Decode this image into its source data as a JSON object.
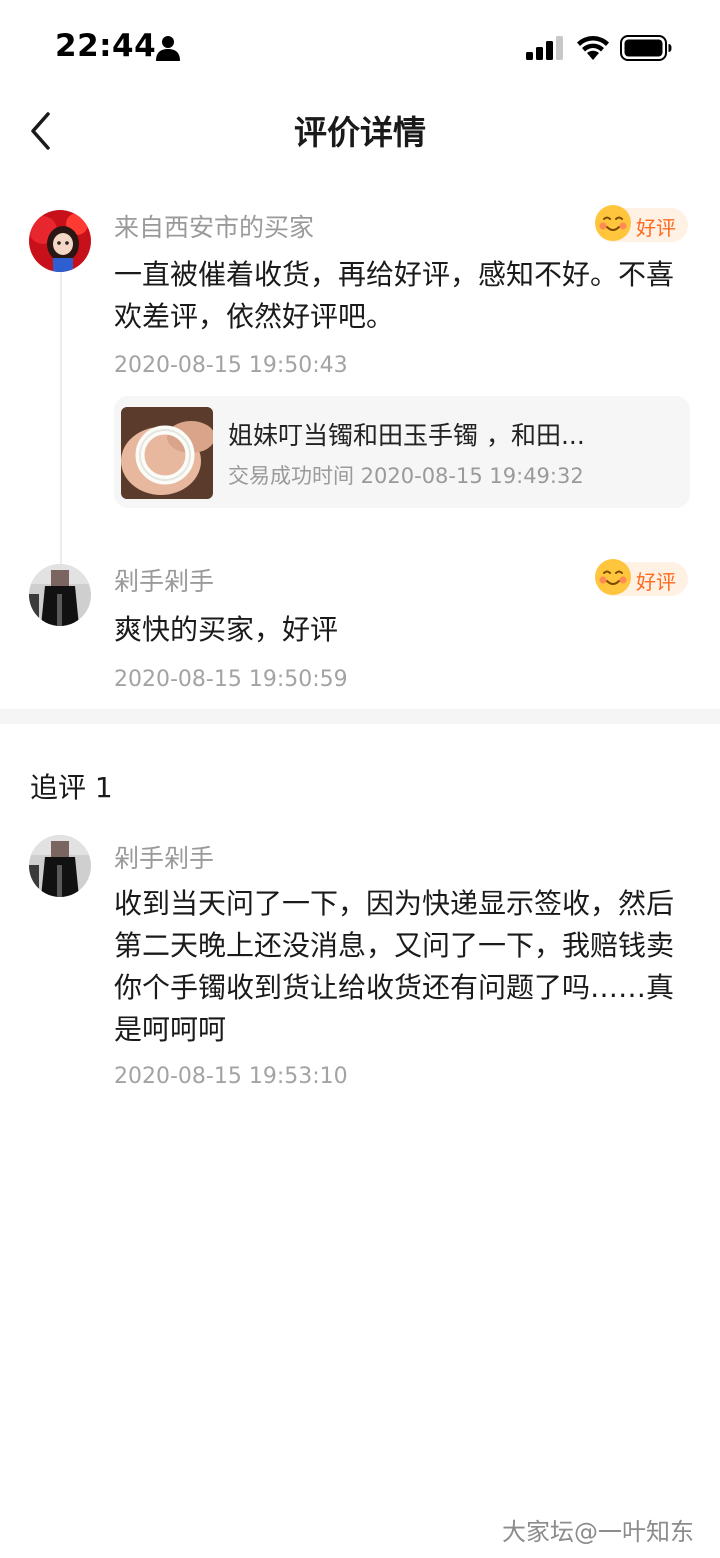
{
  "status_bar": {
    "time": "22:44"
  },
  "nav": {
    "title": "评价详情"
  },
  "reviews": [
    {
      "user": "来自西安市的买家",
      "badge": "好评",
      "text_lines": [
        "一直被催着收货，再给好评，感知不好。不喜",
        "欢差评，依然好评吧。"
      ],
      "time": "2020-08-15 19:50:43"
    },
    {
      "user": "剁手剁手",
      "badge": "好评",
      "text_lines": [
        "爽快的买家，好评"
      ],
      "time": "2020-08-15 19:50:59"
    }
  ],
  "product": {
    "title": "姐妹叮当镯和田玉手镯 ，和田...",
    "trade_time": "交易成功时间 2020-08-15 19:49:32"
  },
  "followup": {
    "title": "追评 1",
    "user": "剁手剁手",
    "text_lines": [
      "收到当天问了一下，因为快递显示签收，然后",
      "第二天晚上还没消息，又问了一下，我赔钱卖",
      "你个手镯收到货让给收货还有问题了吗……真",
      "是呵呵呵"
    ],
    "time": "2020-08-15 19:53:10"
  },
  "watermark": "大家坛@一叶知东",
  "colors": {
    "badge_text": "#ff6a1f",
    "badge_bg": "#fff1e3",
    "muted_text": "#9a9a9a"
  }
}
